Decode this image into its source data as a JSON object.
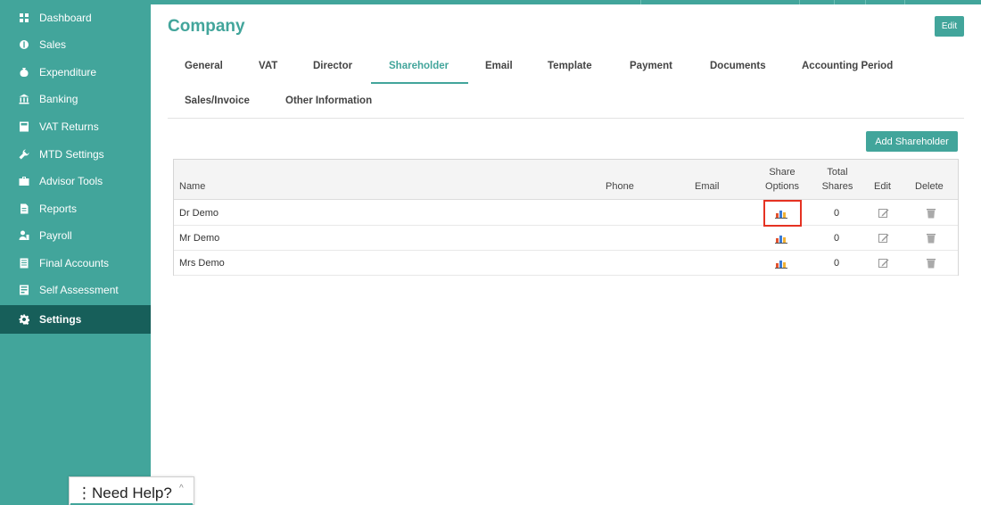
{
  "sidebar": {
    "items": [
      {
        "label": "Dashboard",
        "icon": "grid-icon"
      },
      {
        "label": "Sales",
        "icon": "money-icon"
      },
      {
        "label": "Expenditure",
        "icon": "moneybag-icon"
      },
      {
        "label": "Banking",
        "icon": "bank-icon"
      },
      {
        "label": "VAT Returns",
        "icon": "calculator-icon"
      },
      {
        "label": "MTD Settings",
        "icon": "wrench-icon"
      },
      {
        "label": "Advisor Tools",
        "icon": "briefcase-icon"
      },
      {
        "label": "Reports",
        "icon": "report-icon"
      },
      {
        "label": "Payroll",
        "icon": "payroll-icon"
      },
      {
        "label": "Final Accounts",
        "icon": "ledger-icon"
      },
      {
        "label": "Self Assessment",
        "icon": "form-icon"
      },
      {
        "label": "Settings",
        "icon": "gear-icon"
      }
    ]
  },
  "header": {
    "title": "Company",
    "edit_label": "Edit"
  },
  "tabs": [
    "General",
    "VAT",
    "Director",
    "Shareholder",
    "Email",
    "Template",
    "Payment",
    "Documents",
    "Accounting Period",
    "Sales/Invoice",
    "Other Information"
  ],
  "active_tab": "Shareholder",
  "add_button_label": "Add Shareholder",
  "table": {
    "headers": {
      "name": "Name",
      "phone": "Phone",
      "email": "Email",
      "share_options_1": "Share",
      "share_options_2": "Options",
      "total_shares_1": "Total",
      "total_shares_2": "Shares",
      "edit": "Edit",
      "delete": "Delete"
    },
    "rows": [
      {
        "name": "Dr Demo",
        "phone": "",
        "email": "",
        "total_shares": "0"
      },
      {
        "name": "Mr  Demo",
        "phone": "",
        "email": "",
        "total_shares": "0"
      },
      {
        "name": "Mrs Demo",
        "phone": "",
        "email": "",
        "total_shares": "0"
      }
    ]
  },
  "help_widget": {
    "label": "Need Help?"
  },
  "colors": {
    "accent": "#42a59b",
    "sidebar_active": "#175f5a",
    "highlight": "#e53222"
  }
}
